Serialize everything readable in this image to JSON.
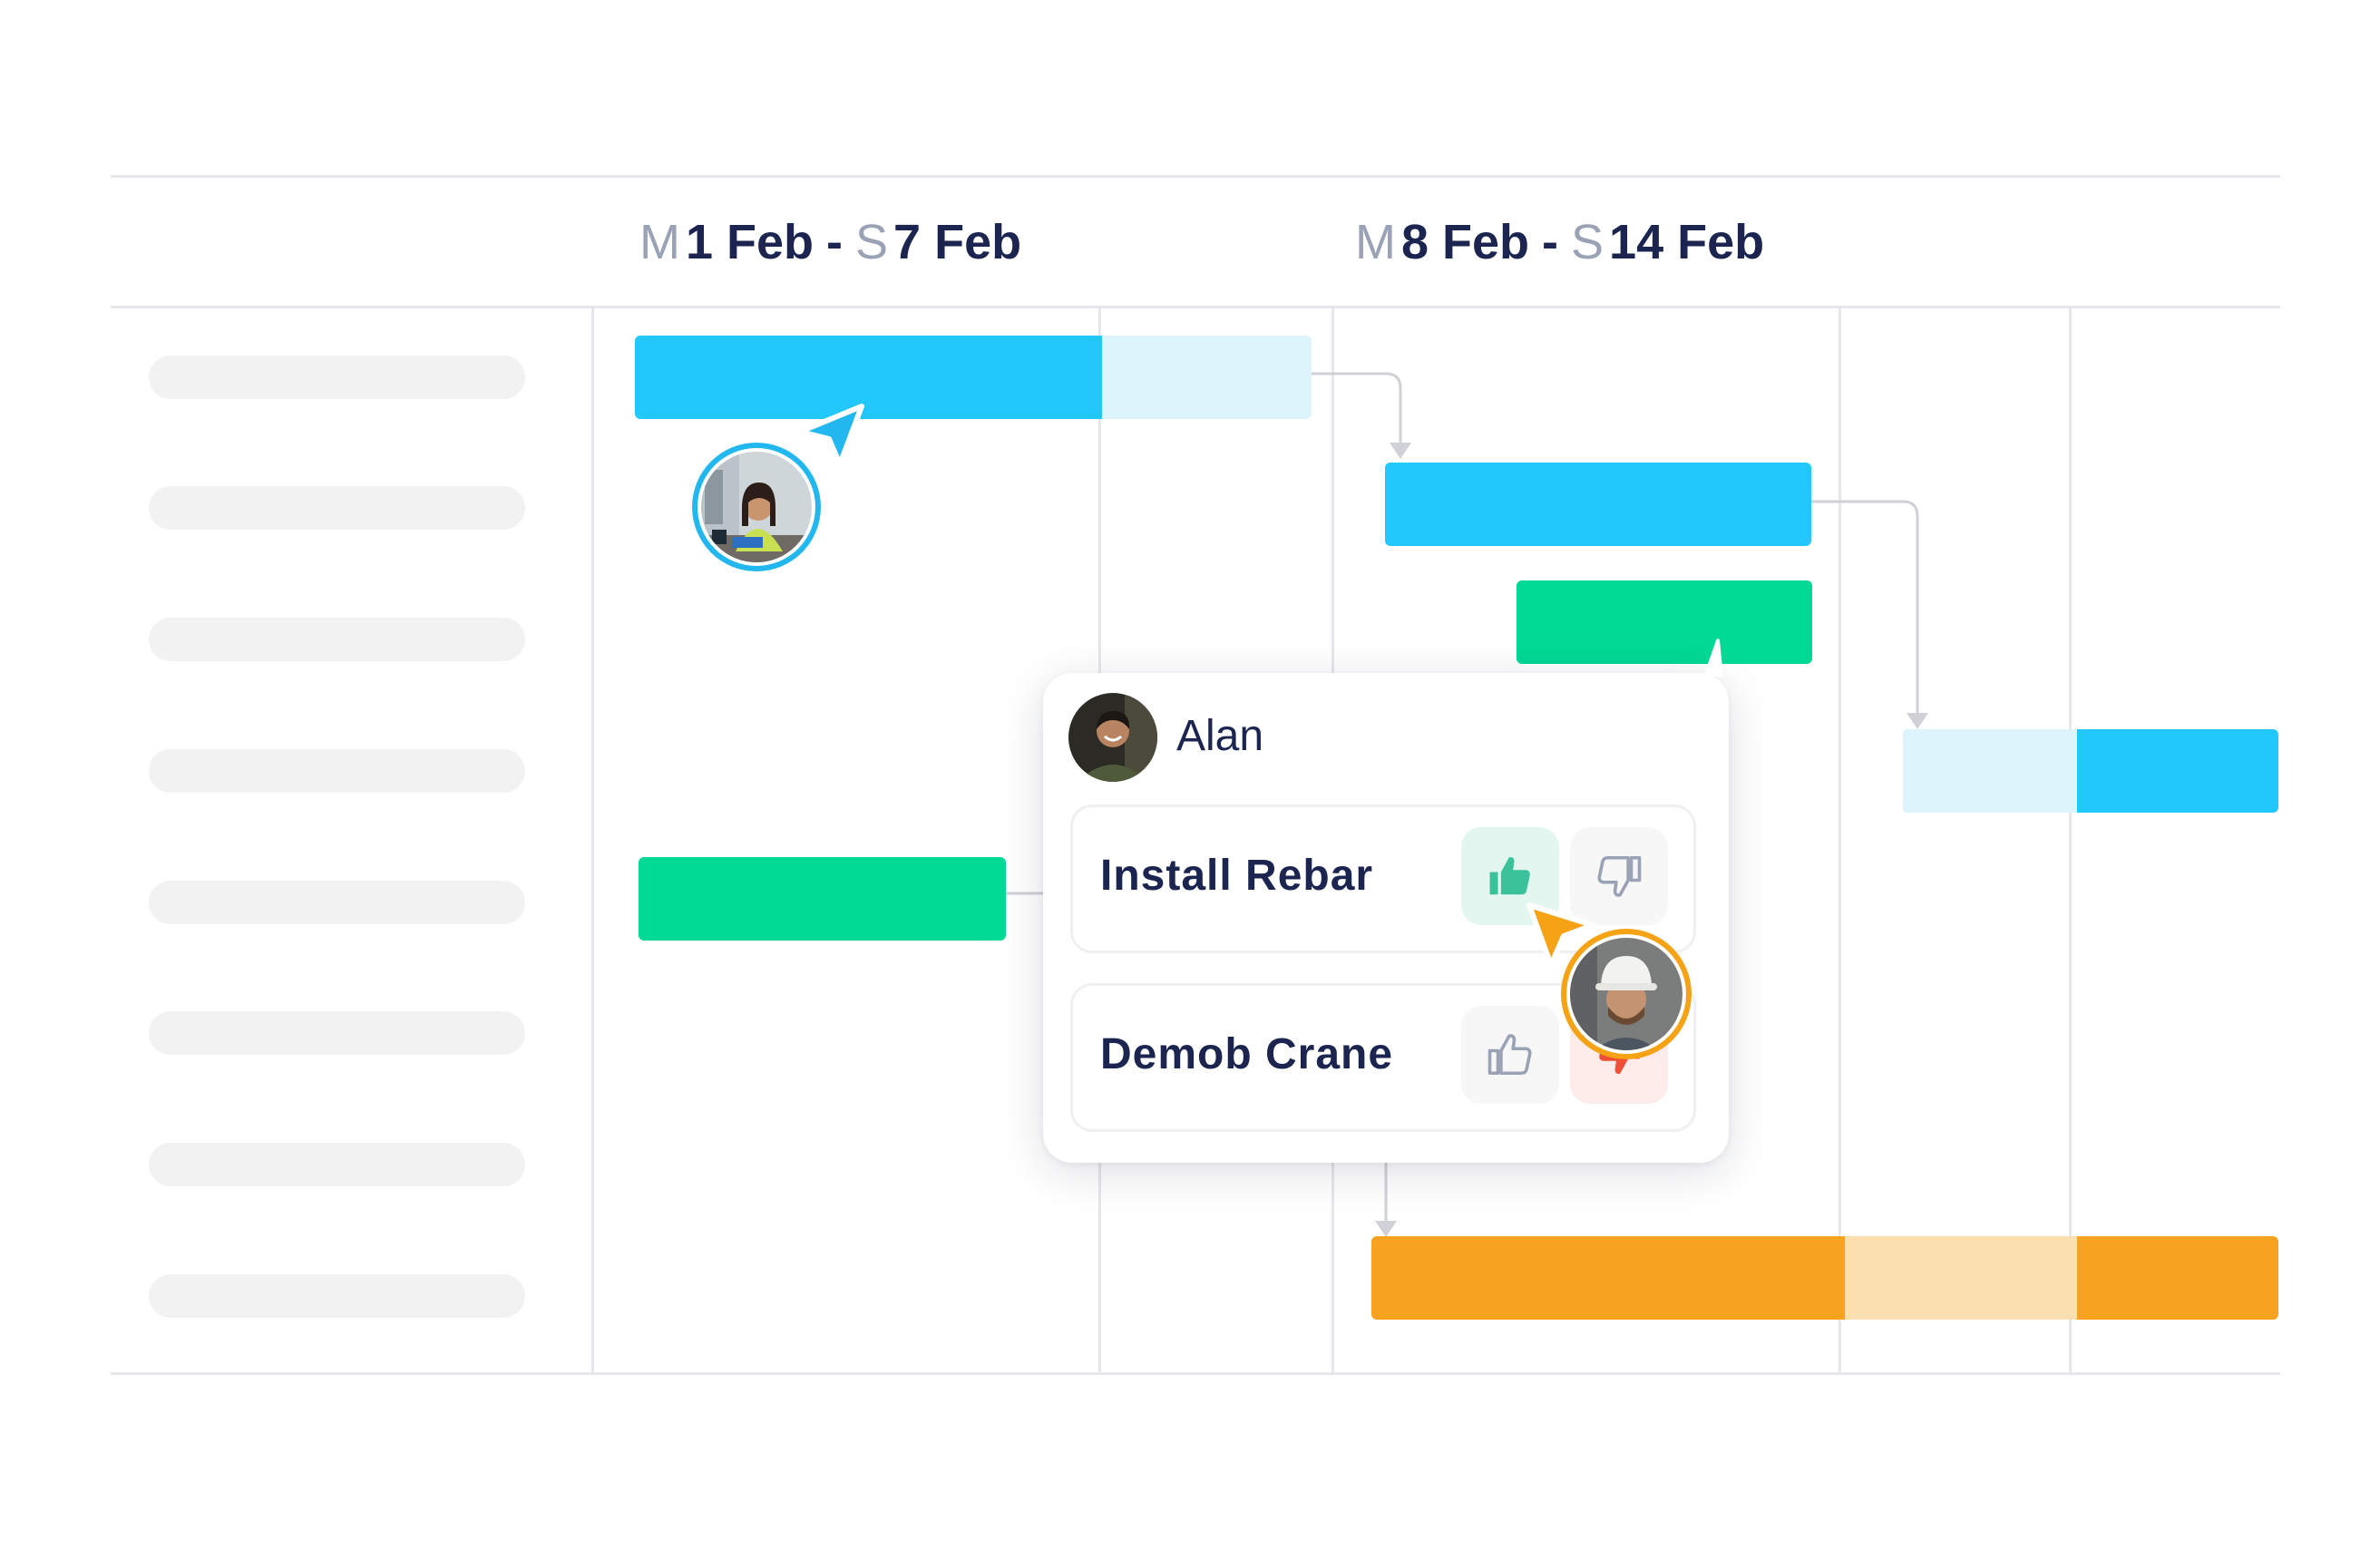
{
  "timeline": {
    "weeks": [
      {
        "start_day": "M",
        "start_date": "1 Feb",
        "separator": "-",
        "end_day": "S",
        "end_date": "7 Feb"
      },
      {
        "start_day": "M",
        "start_date": "8 Feb",
        "separator": "-",
        "end_day": "S",
        "end_date": "14 Feb"
      }
    ]
  },
  "colors": {
    "blue": "#22c7fc",
    "blue_light": "#ddf4fd",
    "green": "#00d994",
    "orange": "#f8a31f",
    "orange_light": "#fbdfb1",
    "cursor_blue": "#22b8ef",
    "cursor_orange": "#f5a214",
    "thumb_up_active": "#3cc29a",
    "thumb_down_active": "#ef4e37"
  },
  "popover": {
    "user_name": "Alan",
    "tasks": [
      {
        "name": "Install Rebar",
        "vote": "up"
      },
      {
        "name": "Demob Crane",
        "vote": "down"
      }
    ]
  },
  "icons": {
    "thumb_up": "thumbs-up-icon",
    "thumb_down": "thumbs-down-icon",
    "cursor": "cursor-arrow-icon"
  }
}
